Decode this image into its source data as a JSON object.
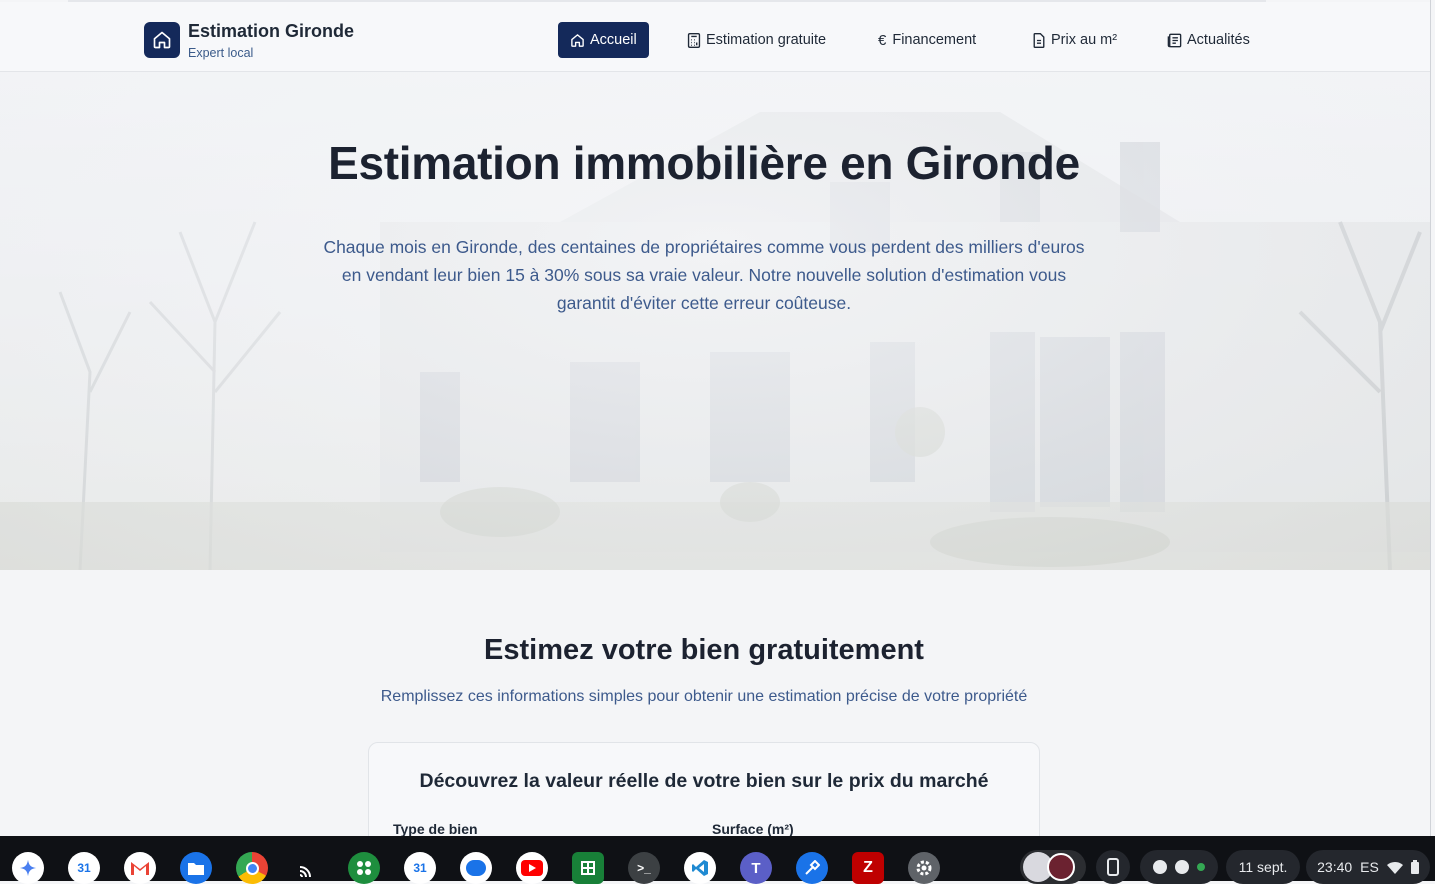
{
  "header": {
    "brand_title": "Estimation Gironde",
    "brand_sub": "Expert local",
    "nav": [
      {
        "label": "Accueil",
        "icon": "home-icon",
        "active": true
      },
      {
        "label": "Estimation gratuite",
        "icon": "calculator-icon",
        "active": false
      },
      {
        "label": "Financement",
        "icon": "euro-icon",
        "active": false
      },
      {
        "label": "Prix au m²",
        "icon": "document-icon",
        "active": false
      },
      {
        "label": "Actualités",
        "icon": "newspaper-icon",
        "active": false
      }
    ]
  },
  "hero": {
    "title": "Estimation immobilière en Gironde",
    "text": "Chaque mois en Gironde, des centaines de propriétaires comme vous perdent des milliers d'euros en vendant leur bien 15 à 30% sous sa vraie valeur. Notre nouvelle solution d'estimation vous garantit d'éviter cette erreur coûteuse."
  },
  "section": {
    "title": "Estimez votre bien gratuitement",
    "subtitle": "Remplissez ces informations simples pour obtenir une estimation précise de votre propriété",
    "card_title": "Découvrez la valeur réelle de votre bien sur le prix du marché",
    "label_type": "Type de bien",
    "label_surface": "Surface (m²)"
  },
  "taskbar": {
    "apps": [
      "launcher-icon",
      "calendar-icon",
      "gmail-icon",
      "files-icon",
      "chrome-icon",
      "cast-icon",
      "apps-icon",
      "calendar-icon",
      "messages-icon",
      "youtube-icon",
      "sheets-icon",
      "terminal-icon",
      "vscode-icon",
      "teams-icon",
      "tool-icon",
      "filezilla-icon",
      "settings-icon"
    ],
    "calendar_day": "31",
    "date": "11 sept.",
    "time": "23:40",
    "lang": "ES"
  },
  "colors": {
    "brand": "#14295a",
    "accent_text": "#3d5a8c",
    "heading": "#1c2230"
  }
}
